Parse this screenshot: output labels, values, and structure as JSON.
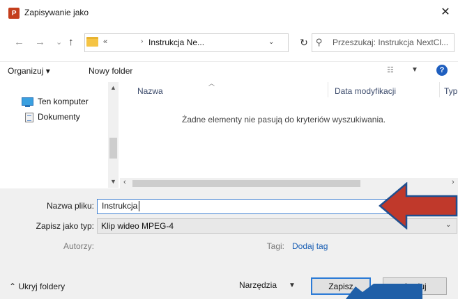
{
  "window": {
    "app_icon_label": "P",
    "title": "Zapisywanie jako",
    "close_glyph": "✕"
  },
  "navigation": {
    "back_glyph": "←",
    "forward_glyph": "→",
    "recent_glyph": "⌄",
    "up_glyph": "↑",
    "address_overflow": "«",
    "address_arrow": "›",
    "address_text": "Instrukcja Ne...",
    "refresh_glyph": "↻",
    "search_placeholder": "Przeszukaj: Instrukcja NextCl..."
  },
  "toolbar": {
    "organize_label": "Organizuj ▾",
    "new_folder_label": "Nowy folder",
    "view_icon": "list-view-icon",
    "help_label": "?"
  },
  "nav_pane": {
    "items": [
      {
        "label": "Ten komputer",
        "icon": "computer-icon"
      },
      {
        "label": "Dokumenty",
        "icon": "documents-icon"
      }
    ]
  },
  "file_list": {
    "columns": [
      "Nazwa",
      "Data modyfikacji",
      "Typ"
    ],
    "empty_message": "Żadne elementy nie pasują do kryteriów wyszukiwania."
  },
  "form": {
    "filename_label": "Nazwa pliku:",
    "filename_value": "Instrukcja",
    "filetype_label": "Zapisz jako typ:",
    "filetype_value": "Klip wideo MPEG-4",
    "authors_label": "Autorzy:",
    "tags_label": "Tagi:",
    "add_tag_label": "Dodaj tag"
  },
  "footer": {
    "hide_folders_label": "Ukryj foldery",
    "tools_label": "Narzędzia",
    "save_label": "Zapisz",
    "cancel_label": "Anuluj"
  },
  "annotations": {
    "red_arrow_color": "#c0392b",
    "blue_arrow_color": "#1f5fa8"
  }
}
